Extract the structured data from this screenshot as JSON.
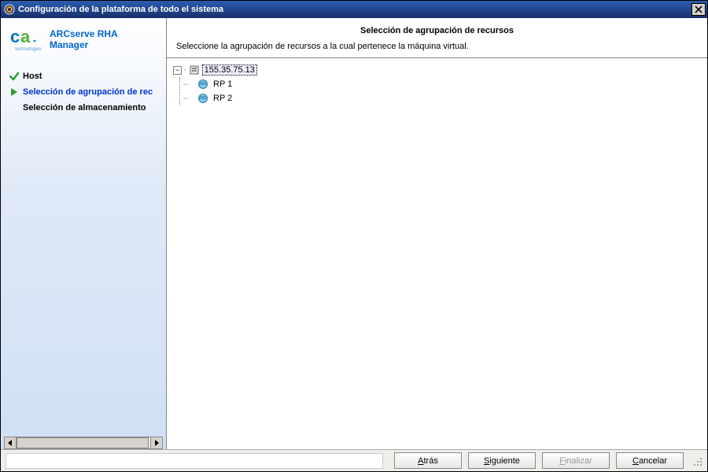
{
  "window": {
    "title": "Configuración de la plataforma de todo el sistema"
  },
  "brand": {
    "line1": "ARCserve RHA",
    "line2": "Manager",
    "logo_sub": "technologies"
  },
  "steps": {
    "done": {
      "label": "Host"
    },
    "current": {
      "label": "Selección de agrupación de rec"
    },
    "pending": {
      "label": "Selección de almacenamiento"
    }
  },
  "header": {
    "title": "Selección de agrupación de recursos",
    "subtitle": "Seleccione la agrupación de recursos a la cual pertenece la máquina virtual."
  },
  "tree": {
    "root": {
      "label": "155.35.75.13",
      "expanded": true,
      "selected": true
    },
    "children": [
      {
        "label": "RP 1"
      },
      {
        "label": "RP 2"
      }
    ]
  },
  "buttons": {
    "back": "Atrás",
    "next": "Siguiente",
    "finish": "Finalizar",
    "cancel": "Cancelar"
  },
  "icons": {
    "close": "close-icon",
    "check": "check-icon",
    "play": "play-icon",
    "host": "host-icon",
    "rp": "resourcepool-icon"
  }
}
